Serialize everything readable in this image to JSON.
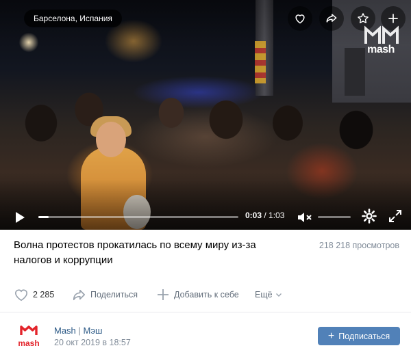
{
  "video": {
    "location": "Барселона, Испания",
    "watermark": "mash",
    "current_time": "0:03",
    "duration": "1:03",
    "progress": 0.05,
    "volume": 0,
    "muted": true,
    "top_actions": [
      "heart-icon",
      "share-arrow-icon",
      "star-icon",
      "plus-icon"
    ]
  },
  "post": {
    "title": "Волна протестов прокатилась по всему миру из-за налогов и коррупции",
    "views": "218 218 просмотров",
    "likes": "2 285",
    "share_label": "Поделиться",
    "add_label": "Добавить к себе",
    "more_label": "Ещё"
  },
  "channel": {
    "name": "Mash",
    "separator": "|",
    "alt_name": "Мэш",
    "date": "20 окт 2019 в 18:57",
    "logo_text": "mash",
    "subscribe_label": "Подписаться"
  },
  "colors": {
    "link": "#2a5885",
    "muted_text": "#818c99",
    "button": "#5181b8",
    "brand_red": "#e3242b"
  }
}
